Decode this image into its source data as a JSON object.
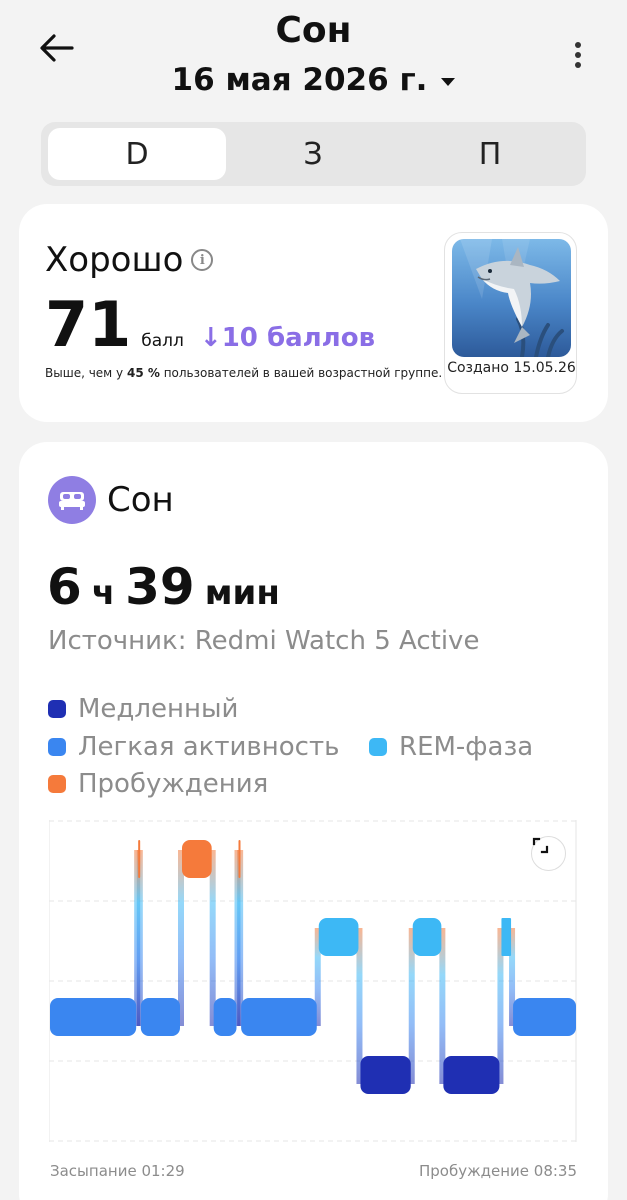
{
  "header": {
    "title": "Сон",
    "date": "16 мая 2026 г."
  },
  "tabs": [
    {
      "label": "D",
      "active": true
    },
    {
      "label": "З",
      "active": false
    },
    {
      "label": "П",
      "active": false
    }
  ],
  "score": {
    "label": "Хорошо",
    "value": "71",
    "unit": "балл",
    "delta": "↓10 баллов",
    "note_prefix": "Выше, чем у ",
    "note_percent": "45 %",
    "note_suffix": " пользователей в вашей возрастной группе.",
    "badge_caption": "Создано 15.05.26"
  },
  "sleep": {
    "title": "Сон",
    "duration_hours": "6",
    "duration_h_unit": "ч",
    "duration_minutes": "39",
    "duration_m_unit": "мин",
    "source": "Источник: Redmi Watch 5 Active",
    "legend": [
      {
        "label": "Медленный",
        "color": "#1f2fb3"
      },
      {
        "label": "Легкая активность",
        "color": "#3a86f0"
      },
      {
        "label": "REM-фаза",
        "color": "#3db8f5"
      },
      {
        "label": "Пробуждения",
        "color": "#f57a3b"
      }
    ],
    "start_label": "Засыпание 01:29",
    "end_label": "Пробуждение 08:35"
  },
  "chart_data": {
    "type": "bar",
    "stage_order": [
      "Пробуждения",
      "REM-фаза",
      "Легкая активность",
      "Медленный"
    ],
    "segments": [
      {
        "stage": "Легкая активность",
        "start_frac": 0.0,
        "end_frac": 0.167
      },
      {
        "stage": "Пробуждения",
        "start_frac": 0.167,
        "end_frac": 0.172
      },
      {
        "stage": "Легкая активность",
        "start_frac": 0.172,
        "end_frac": 0.25
      },
      {
        "stage": "Пробуждения",
        "start_frac": 0.25,
        "end_frac": 0.31
      },
      {
        "stage": "Легкая активность",
        "start_frac": 0.31,
        "end_frac": 0.357
      },
      {
        "stage": "Пробуждения",
        "start_frac": 0.357,
        "end_frac": 0.362
      },
      {
        "stage": "Легкая активность",
        "start_frac": 0.362,
        "end_frac": 0.509
      },
      {
        "stage": "REM-фаза",
        "start_frac": 0.509,
        "end_frac": 0.588
      },
      {
        "stage": "Медленный",
        "start_frac": 0.588,
        "end_frac": 0.687
      },
      {
        "stage": "REM-фаза",
        "start_frac": 0.687,
        "end_frac": 0.745
      },
      {
        "stage": "Медленный",
        "start_frac": 0.745,
        "end_frac": 0.855
      },
      {
        "stage": "REM-фаза",
        "start_frac": 0.855,
        "end_frac": 0.877
      },
      {
        "stage": "Легкая активность",
        "start_frac": 0.877,
        "end_frac": 1.0
      }
    ]
  }
}
